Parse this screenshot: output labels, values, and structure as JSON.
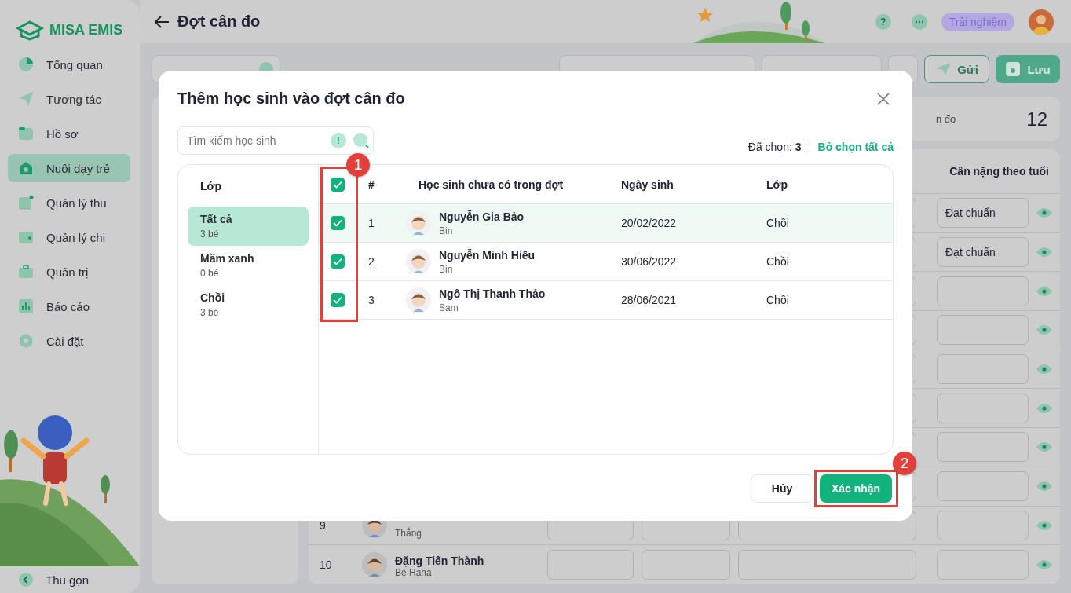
{
  "sidebar": {
    "logo": "MISA EMIS",
    "items": [
      {
        "label": "Tổng quan",
        "selected": false
      },
      {
        "label": "Tương tác",
        "selected": false
      },
      {
        "label": "Hồ sơ",
        "selected": false
      },
      {
        "label": "Nuôi dạy trẻ",
        "selected": true
      },
      {
        "label": "Quản lý thu",
        "selected": false
      },
      {
        "label": "Quản lý chi",
        "selected": false
      },
      {
        "label": "Quản trị",
        "selected": false
      },
      {
        "label": "Báo cáo",
        "selected": false
      },
      {
        "label": "Cài đặt",
        "selected": false
      }
    ],
    "collapse": "Thu gọn"
  },
  "header": {
    "title": "Đợt cân đo",
    "help": "?",
    "more": "⋯",
    "badge": "Trải nghiệm"
  },
  "toolbar": {
    "send": "Gửi",
    "save": "Lưu"
  },
  "stat": {
    "label": "n đo",
    "value": "12"
  },
  "table": {
    "column": "Cân nặng theo tuổi",
    "rows": [
      {
        "kind": "covered",
        "weight_status": "Đạt chuẩn"
      },
      {
        "kind": "covered",
        "weight_status": "Đạt chuẩn"
      },
      {
        "kind": "covered"
      },
      {
        "kind": "covered"
      },
      {
        "kind": "covered"
      },
      {
        "kind": "covered"
      },
      {
        "kind": "covered"
      },
      {
        "kind": "covered"
      },
      {
        "kind": "full",
        "number": "9",
        "nickname": "Thắng"
      },
      {
        "kind": "full",
        "number": "10",
        "name": "Đặng Tiến Thành",
        "nickname": "Bé Haha"
      }
    ]
  },
  "dialog": {
    "title": "Thêm học sinh vào đợt cân đo",
    "search_placeholder": "Tìm kiếm học sinh",
    "hint": "!",
    "selected_label": "Đã chọn:",
    "selected_count": "3",
    "clear_all": "Bỏ chọn tất cả",
    "class_heading": "Lớp",
    "classes": [
      {
        "name": "Tất cả",
        "count": "3 bé",
        "selected": true
      },
      {
        "name": "Mầm xanh",
        "count": "0 bé",
        "selected": false
      },
      {
        "name": "Chồi",
        "count": "3 bé",
        "selected": false
      }
    ],
    "all_checked": true,
    "columns": [
      "#",
      "Học sinh chưa có trong đợt",
      "Ngày sinh",
      "Lớp"
    ],
    "students": [
      {
        "number": "1",
        "name": "Nguyễn Gia Bảo",
        "nickname": "Bin",
        "dob": "20/02/2022",
        "class": "Chồi",
        "checked": true,
        "highlighted": true
      },
      {
        "number": "2",
        "name": "Nguyễn Minh Hiếu",
        "nickname": "Bin",
        "dob": "30/06/2022",
        "class": "Chồi",
        "checked": true,
        "highlighted": false
      },
      {
        "number": "3",
        "name": "Ngô Thị Thanh Thảo",
        "nickname": "Sam",
        "dob": "28/06/2021",
        "class": "Chồi",
        "checked": true,
        "highlighted": false
      }
    ],
    "cancel": "Hủy",
    "confirm": "Xác nhận"
  },
  "callouts": [
    {
      "number": "1"
    },
    {
      "number": "2"
    }
  ]
}
